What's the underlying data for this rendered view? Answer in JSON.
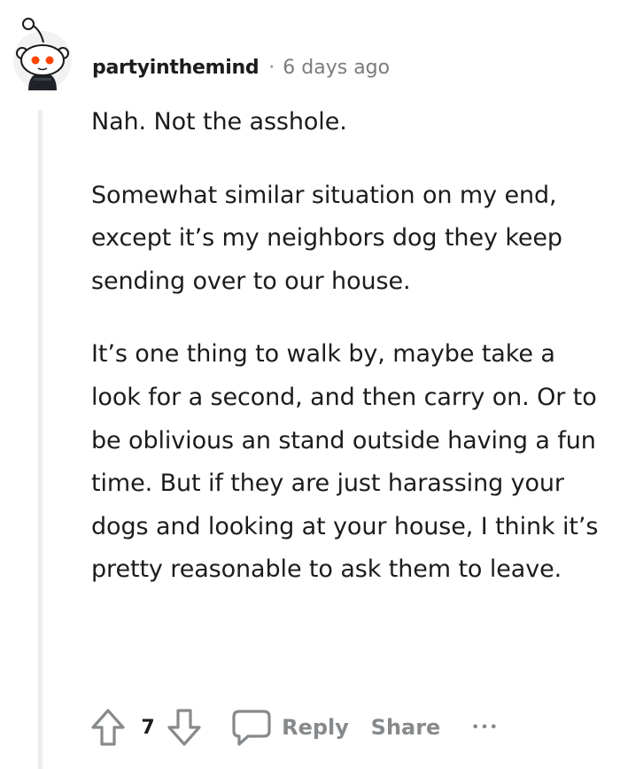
{
  "comment": {
    "username": "partyinthemind",
    "separator": "·",
    "timestamp": "6 days ago",
    "paragraphs": [
      "Nah. Not the asshole.",
      "Somewhat similar situation on my end, except it’s my neighbors dog they keep sending over to our house.",
      "It’s one thing to walk by, maybe take a look for a second, and then carry on. Or to be oblivious an stand outside having a fun time. But if they are just harassing your dogs and looking at your house, I think it’s pretty reasonable to ask them to leave."
    ]
  },
  "actions": {
    "vote_count": "7",
    "reply_label": "Reply",
    "share_label": "Share",
    "more_label": "•••"
  },
  "icons": {
    "avatar": "snoo-avatar-icon",
    "upvote": "upvote-arrow-icon",
    "downvote": "downvote-arrow-icon",
    "comment": "comment-bubble-icon",
    "more": "more-options-icon"
  },
  "colors": {
    "text": "#1c1c1c",
    "muted": "#878a8c",
    "thread_line": "#ededed",
    "snoo_eye": "#ff4500"
  }
}
